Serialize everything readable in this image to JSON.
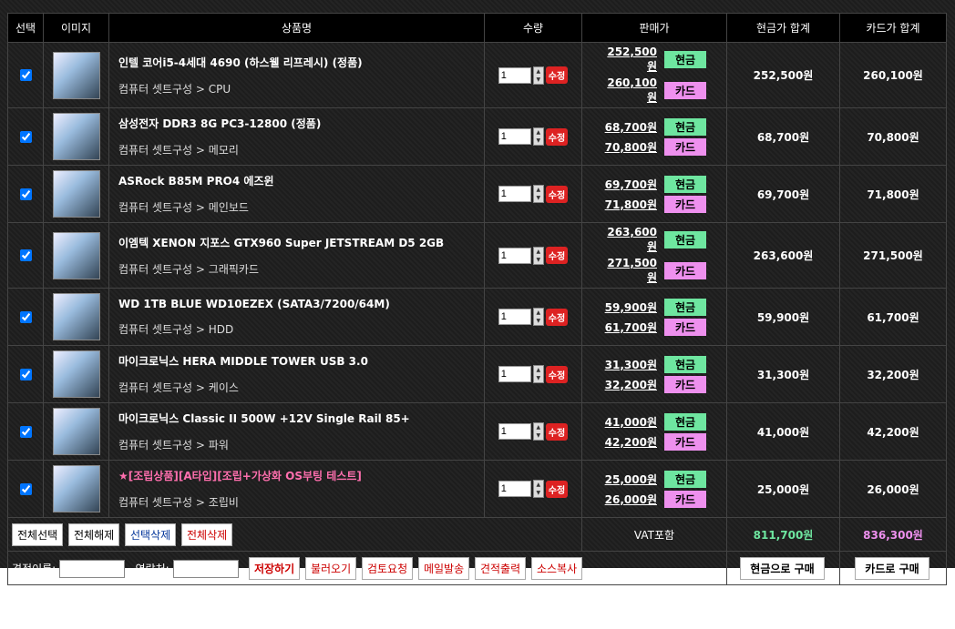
{
  "headers": [
    "선택",
    "이미지",
    "상품명",
    "수량",
    "판매가",
    "현금가 합계",
    "카드가 합계"
  ],
  "tags": {
    "cash": "현금",
    "card": "카드",
    "fix": "수정"
  },
  "items": [
    {
      "name": "인텔 코어i5-4세대 4690 (하스웰 리프레시) (정품)",
      "cat": "컴퓨터 셋트구성 > CPU",
      "qty": "1",
      "cash": "252,500원",
      "card": "260,100원",
      "cash_sum": "252,500원",
      "card_sum": "260,100원"
    },
    {
      "name": "삼성전자 DDR3 8G PC3-12800 (정품)",
      "cat": "컴퓨터 셋트구성 > 메모리",
      "qty": "1",
      "cash": "68,700원",
      "card": "70,800원",
      "cash_sum": "68,700원",
      "card_sum": "70,800원"
    },
    {
      "name": "ASRock B85M PRO4 에즈윈",
      "cat": "컴퓨터 셋트구성 > 메인보드",
      "qty": "1",
      "cash": "69,700원",
      "card": "71,800원",
      "cash_sum": "69,700원",
      "card_sum": "71,800원"
    },
    {
      "name": "이엠텍 XENON 지포스 GTX960 Super JETSTREAM D5 2GB",
      "cat": "컴퓨터 셋트구성 > 그래픽카드",
      "qty": "1",
      "cash": "263,600원",
      "card": "271,500원",
      "cash_sum": "263,600원",
      "card_sum": "271,500원"
    },
    {
      "name": "WD 1TB BLUE WD10EZEX (SATA3/7200/64M)",
      "cat": "컴퓨터 셋트구성 > HDD",
      "qty": "1",
      "cash": "59,900원",
      "card": "61,700원",
      "cash_sum": "59,900원",
      "card_sum": "61,700원"
    },
    {
      "name": "마이크로닉스 HERA MIDDLE TOWER USB 3.0",
      "cat": "컴퓨터 셋트구성 > 케이스",
      "qty": "1",
      "cash": "31,300원",
      "card": "32,200원",
      "cash_sum": "31,300원",
      "card_sum": "32,200원"
    },
    {
      "name": "마이크로닉스 Classic II 500W +12V Single Rail 85+",
      "cat": "컴퓨터 셋트구성 > 파워",
      "qty": "1",
      "cash": "41,000원",
      "card": "42,200원",
      "cash_sum": "41,000원",
      "card_sum": "42,200원"
    },
    {
      "name": "★[조립상품][A타입][조립+가상화 OS부팅 테스트]",
      "cat": "컴퓨터 셋트구성 > 조립비",
      "qty": "1",
      "cash": "25,000원",
      "card": "26,000원",
      "cash_sum": "25,000원",
      "card_sum": "26,000원",
      "highlight": true
    }
  ],
  "footer": {
    "select_all": "전체선택",
    "deselect_all": "전체해제",
    "delete_selected": "선택삭제",
    "delete_all": "전체삭제",
    "vat": "VAT포함",
    "cash_total": "811,700원",
    "card_total": "836,300원",
    "est_name_label": "견적이름:",
    "contact_label": "연락처:",
    "save": "저장하기",
    "load": "불러오기",
    "review": "검토요청",
    "mail": "메일발송",
    "print": "견적출력",
    "copy": "소스복사",
    "buy_cash": "현금으로 구매",
    "buy_card": "카드로 구매"
  },
  "colors": {
    "cash": "#6ee6a0",
    "card": "#ee90ee"
  }
}
